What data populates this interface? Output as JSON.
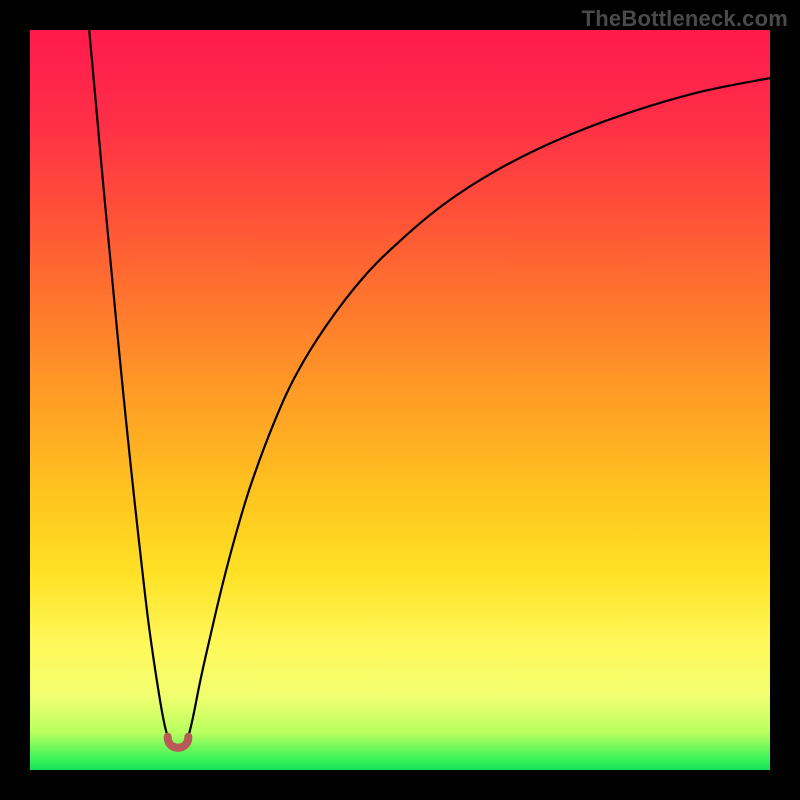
{
  "watermark": "TheBottleneck.com",
  "chart_data": {
    "type": "line",
    "title": "",
    "xlabel": "",
    "ylabel": "",
    "xlim": [
      0,
      100
    ],
    "ylim": [
      0,
      100
    ],
    "notch_x": 20,
    "notch_floor_y": 3.5,
    "left_curve": {
      "x": [
        8,
        9,
        10,
        11,
        12,
        13,
        14,
        15,
        16,
        17,
        18,
        18.6
      ],
      "y": [
        100,
        89,
        78,
        67.5,
        57,
        47,
        37.5,
        28.5,
        20,
        13,
        7,
        4.5
      ]
    },
    "right_curve": {
      "x": [
        21.4,
        22,
        23,
        24,
        26,
        28,
        30,
        33,
        36,
        40,
        45,
        50,
        56,
        63,
        71,
        80,
        90,
        100
      ],
      "y": [
        4.5,
        7,
        12,
        16.5,
        25,
        32.5,
        39,
        47,
        53.5,
        60,
        66.5,
        71.5,
        76.5,
        81,
        85,
        88.5,
        91.5,
        93.5
      ]
    },
    "notch_arc": {
      "from_x": 18.6,
      "from_y": 4.5,
      "to_x": 21.4,
      "to_y": 4.5,
      "bottom_y": 3.0
    },
    "background_gradient_vertical": [
      {
        "offset": 0.0,
        "color": "#ff1a4d"
      },
      {
        "offset": 0.12,
        "color": "#ff2e47"
      },
      {
        "offset": 0.25,
        "color": "#ff5138"
      },
      {
        "offset": 0.38,
        "color": "#ff7a2c"
      },
      {
        "offset": 0.5,
        "color": "#ff9e25"
      },
      {
        "offset": 0.62,
        "color": "#ffc21f"
      },
      {
        "offset": 0.73,
        "color": "#ffe024"
      },
      {
        "offset": 0.83,
        "color": "#fff85a"
      },
      {
        "offset": 0.9,
        "color": "#f2ff70"
      },
      {
        "offset": 0.95,
        "color": "#b7ff5e"
      },
      {
        "offset": 0.985,
        "color": "#3cf45a"
      },
      {
        "offset": 1.0,
        "color": "#14e05a"
      }
    ],
    "curve_stroke": "#000000",
    "notch_stroke": "#b85a56"
  }
}
